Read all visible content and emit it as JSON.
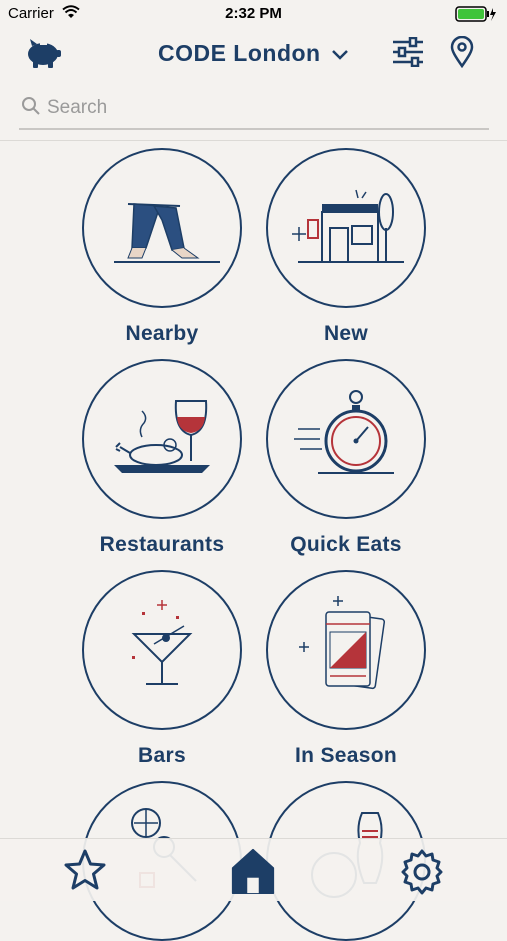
{
  "status": {
    "carrier": "Carrier",
    "time": "2:32 PM"
  },
  "header": {
    "city": "CODE London"
  },
  "search": {
    "placeholder": "Search"
  },
  "categories": [
    {
      "label": "Nearby"
    },
    {
      "label": "New"
    },
    {
      "label": "Restaurants"
    },
    {
      "label": "Quick Eats"
    },
    {
      "label": "Bars"
    },
    {
      "label": "In Season"
    }
  ],
  "colors": {
    "navy": "#1d3e66",
    "red": "#b5343a",
    "background": "#f4f2ef"
  },
  "tabs": [
    {
      "icon": "star-icon",
      "active": false
    },
    {
      "icon": "home-icon",
      "active": true
    },
    {
      "icon": "gear-icon",
      "active": false
    }
  ]
}
